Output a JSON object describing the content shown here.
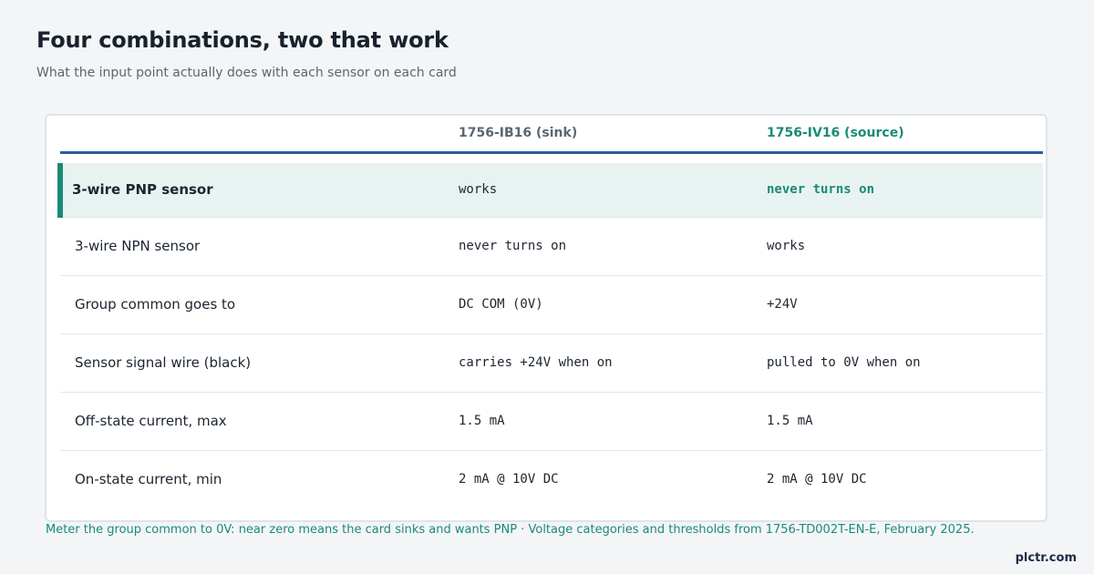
{
  "header": {
    "title": "Four combinations, two that work",
    "subtitle": "What the input point actually does with each sensor on each card"
  },
  "table": {
    "columns": [
      "",
      "1756-IB16 (sink)",
      "1756-IV16 (source)"
    ],
    "rows": [
      {
        "label": "3-wire PNP sensor",
        "sink": "works",
        "source": "never turns on",
        "highlighted": true
      },
      {
        "label": "3-wire NPN sensor",
        "sink": "never turns on",
        "source": "works"
      },
      {
        "label": "Group common goes to",
        "sink": "DC COM (0V)",
        "source": "+24V"
      },
      {
        "label": "Sensor signal wire (black)",
        "sink": "carries +24V when on",
        "source": "pulled to 0V when on"
      },
      {
        "label": "Off-state current, max",
        "sink": "1.5 mA",
        "source": "1.5 mA"
      },
      {
        "label": "On-state current, min",
        "sink": "2 mA @ 10V DC",
        "source": "2 mA @ 10V DC"
      }
    ]
  },
  "footnote": "Meter the group common to 0V: near zero means the card sinks and wants PNP · Voltage categories and thresholds from 1756-TD002T-EN-E, February 2025.",
  "brand": "plctr.com",
  "colors": {
    "accent": "#1a8b78",
    "header_rule": "#2c5aa0",
    "highlight_row": "#e8f3f1"
  }
}
